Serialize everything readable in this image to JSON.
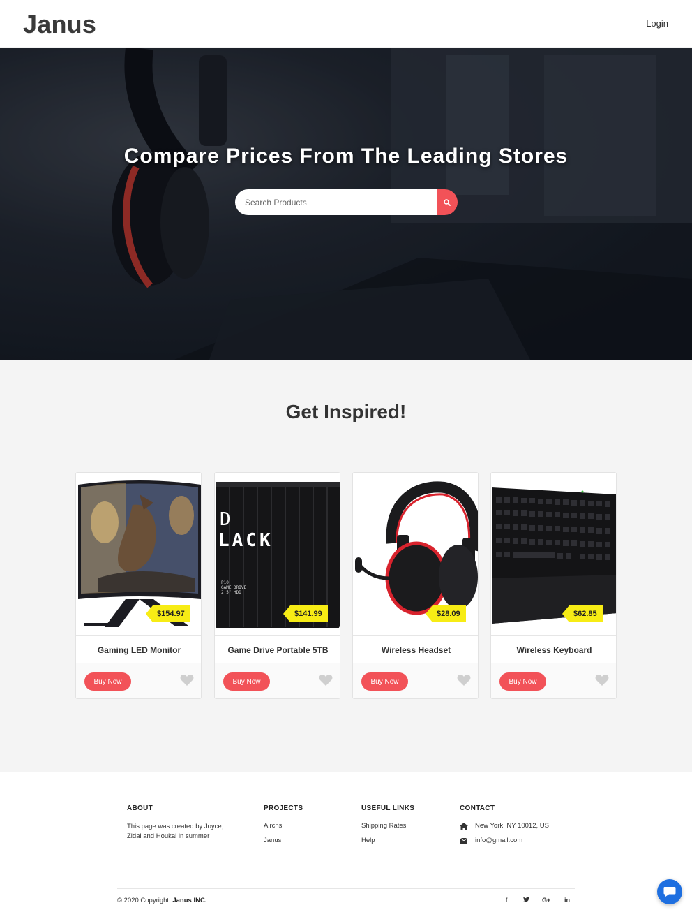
{
  "header": {
    "brand": "Janus",
    "login": "Login"
  },
  "hero": {
    "title": "Compare Prices From The Leading Stores",
    "search_placeholder": "Search Products",
    "search_icon": "search-icon"
  },
  "inspired": {
    "title": "Get Inspired!",
    "products": [
      {
        "name": "Gaming LED Monitor",
        "price": "$154.97",
        "buy": "Buy Now"
      },
      {
        "name": "Game Drive Portable 5TB",
        "price": "$141.99",
        "buy": "Buy Now"
      },
      {
        "name": "Wireless Headset",
        "price": "$28.09",
        "buy": "Buy Now"
      },
      {
        "name": "Wireless Keyboard",
        "price": "$62.85",
        "buy": "Buy Now"
      }
    ]
  },
  "footer": {
    "about": {
      "heading": "ABOUT",
      "text": "This page was created by Joyce, Zidai and Houkai in summer"
    },
    "projects": {
      "heading": "PROJECTS",
      "links": [
        "Aircns",
        "Janus"
      ]
    },
    "useful": {
      "heading": "USEFUL LINKS",
      "links": [
        "Shipping Rates",
        "Help"
      ]
    },
    "contact": {
      "heading": "CONTACT",
      "address": "New York, NY 10012, US",
      "email": "info@gmail.com"
    },
    "copyright_prefix": "© 2020 Copyright:",
    "copyright_owner": "Janus INC.",
    "social": [
      "f",
      "t",
      "G+",
      "in"
    ]
  },
  "colors": {
    "accent": "#f25258",
    "price_tag": "#f7ec15",
    "chat": "#1e6fe0"
  }
}
